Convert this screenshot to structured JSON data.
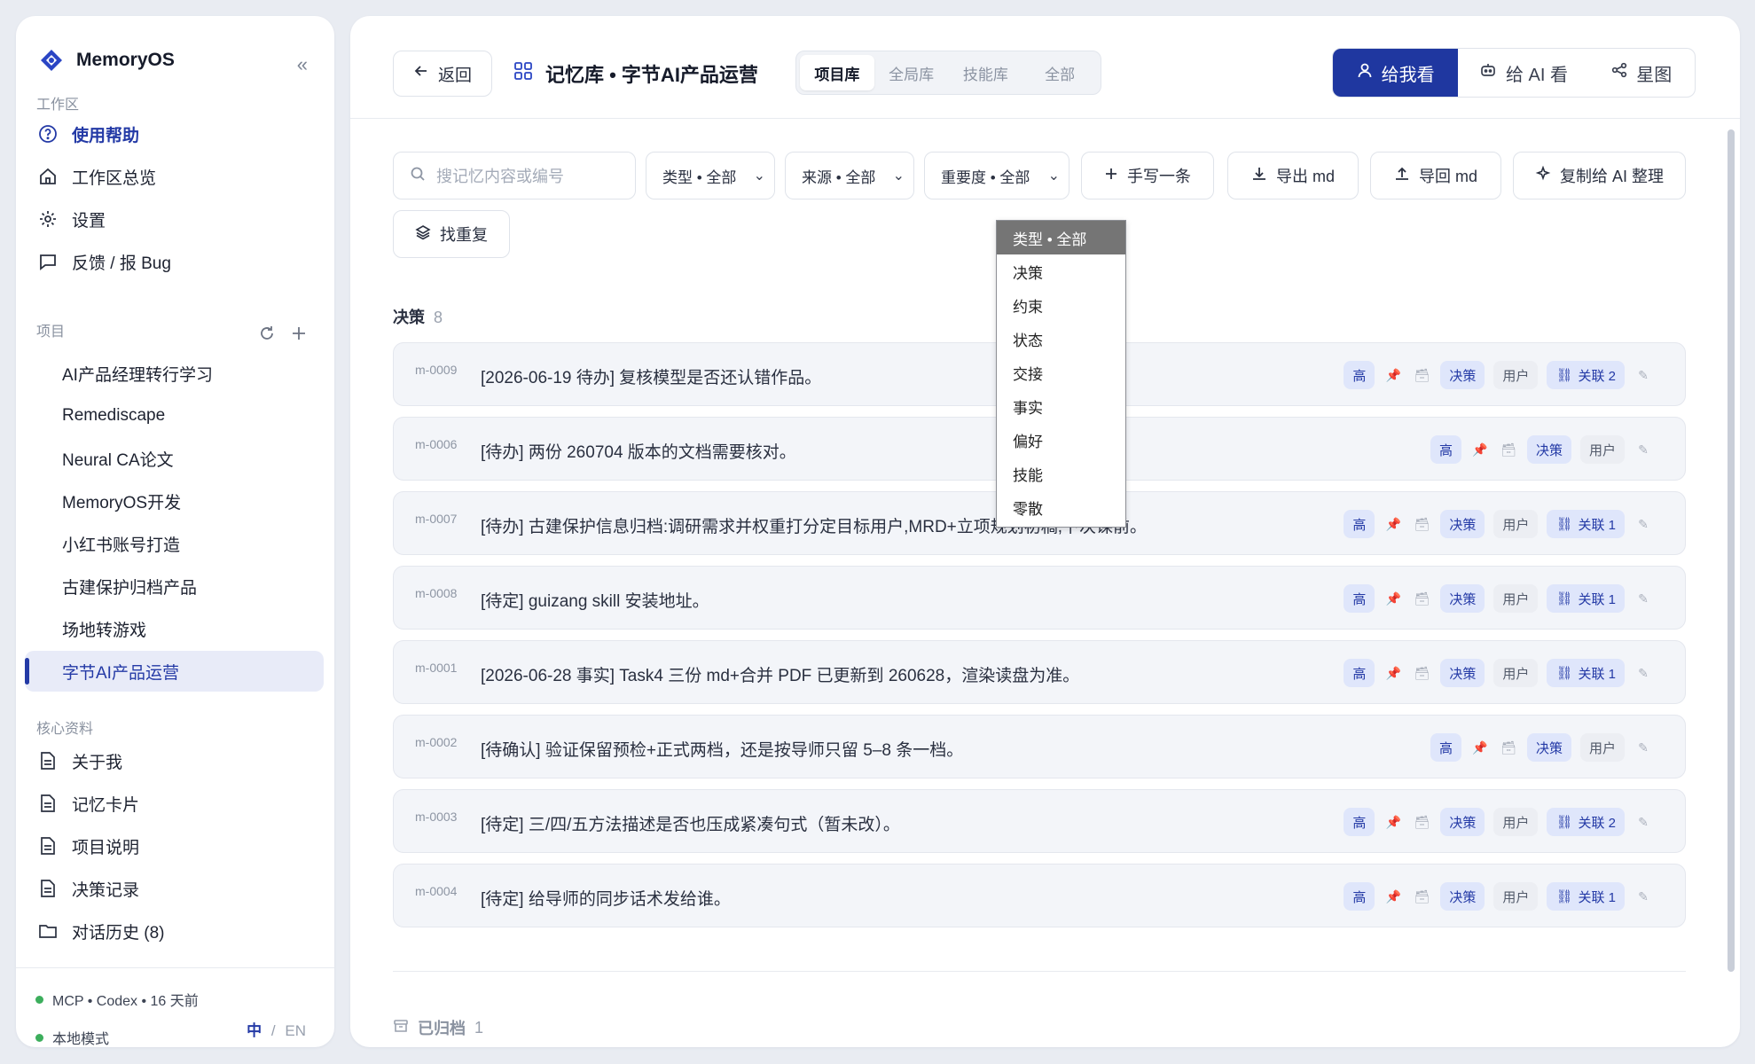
{
  "brand": {
    "name": "MemoryOS",
    "collapse": "«"
  },
  "sidebar": {
    "workspace_label": "工作区",
    "workspace": [
      {
        "label": "使用帮助",
        "icon": "help-circle-icon"
      },
      {
        "label": "工作区总览",
        "icon": "home-icon"
      },
      {
        "label": "设置",
        "icon": "gear-icon"
      },
      {
        "label": "反馈 / 报 Bug",
        "icon": "chat-bubble-icon"
      }
    ],
    "projects_label": "项目",
    "projects": [
      "AI产品经理转行学习",
      "Remediscape",
      "Neural CA论文",
      "MemoryOS开发",
      "小红书账号打造",
      "古建保护归档产品",
      "场地转游戏",
      "字节AI产品运营"
    ],
    "core_label": "核心资料",
    "core": [
      {
        "label": "关于我",
        "icon": "document-icon"
      },
      {
        "label": "记忆卡片",
        "icon": "document-icon"
      },
      {
        "label": "项目说明",
        "icon": "document-icon"
      },
      {
        "label": "决策记录",
        "icon": "document-icon"
      },
      {
        "label": "对话历史 (8)",
        "icon": "folder-icon"
      }
    ],
    "footer": {
      "status": "MCP • Codex • 16 天前",
      "mode": "本地模式",
      "lang_zh": "中",
      "lang_sep": "/",
      "lang_en": "EN"
    }
  },
  "header": {
    "back": "返回",
    "title": "记忆库 • 字节AI产品运营",
    "scopes": [
      "项目库",
      "全局库",
      "技能库",
      "全部"
    ],
    "views": [
      "给我看",
      "给 AI 看",
      "星图"
    ]
  },
  "filters": {
    "search_placeholder": "搜记忆内容或编号",
    "type": "类型 • 全部",
    "source": "来源 • 全部",
    "importance": "重要度 • 全部",
    "actions": [
      "手写一条",
      "导出 md",
      "导回 md",
      "复制给 AI 整理",
      "找重复"
    ]
  },
  "dropdown": {
    "options": [
      "类型 • 全部",
      "决策",
      "约束",
      "状态",
      "交接",
      "事实",
      "偏好",
      "技能",
      "零散"
    ],
    "selected_index": 0
  },
  "group": {
    "name": "决策",
    "count": "8"
  },
  "memories": [
    {
      "id": "m-0009",
      "text": "[2026-06-19 待办] 复核模型是否还认错作品。",
      "imp": "高",
      "kind": "决策",
      "src": "用户",
      "link": "关联 2"
    },
    {
      "id": "m-0006",
      "text": "[待办] 两份 260704 版本的文档需要核对。",
      "imp": "高",
      "kind": "决策",
      "src": "用户",
      "link": ""
    },
    {
      "id": "m-0007",
      "text": "[待办] 古建保护信息归档:调研需求并权重打分定目标用户,MRD+立项规划初稿,下次课前。",
      "imp": "高",
      "kind": "决策",
      "src": "用户",
      "link": "关联 1"
    },
    {
      "id": "m-0008",
      "text": "[待定] guizang skill 安装地址。",
      "imp": "高",
      "kind": "决策",
      "src": "用户",
      "link": "关联 1"
    },
    {
      "id": "m-0001",
      "text": "[2026-06-28 事实] Task4 三份 md+合并 PDF 已更新到 260628，渲染读盘为准。",
      "imp": "高",
      "kind": "决策",
      "src": "用户",
      "link": "关联 1"
    },
    {
      "id": "m-0002",
      "text": "[待确认] 验证保留预检+正式两档，还是按导师只留 5–8 条一档。",
      "imp": "高",
      "kind": "决策",
      "src": "用户",
      "link": ""
    },
    {
      "id": "m-0003",
      "text": "[待定] 三/四/五方法描述是否也压成紧凑句式（暂未改）。",
      "imp": "高",
      "kind": "决策",
      "src": "用户",
      "link": "关联 2"
    },
    {
      "id": "m-0004",
      "text": "[待定] 给导师的同步话术发给谁。",
      "imp": "高",
      "kind": "决策",
      "src": "用户",
      "link": "关联 1"
    }
  ],
  "archived": {
    "label": "已归档",
    "count": "1"
  },
  "colors": {
    "accent": "#1f37a0",
    "tag_bg": "#dfe6fb",
    "row_bg": "#f3f5f9",
    "status_green": "#3cae5c"
  }
}
